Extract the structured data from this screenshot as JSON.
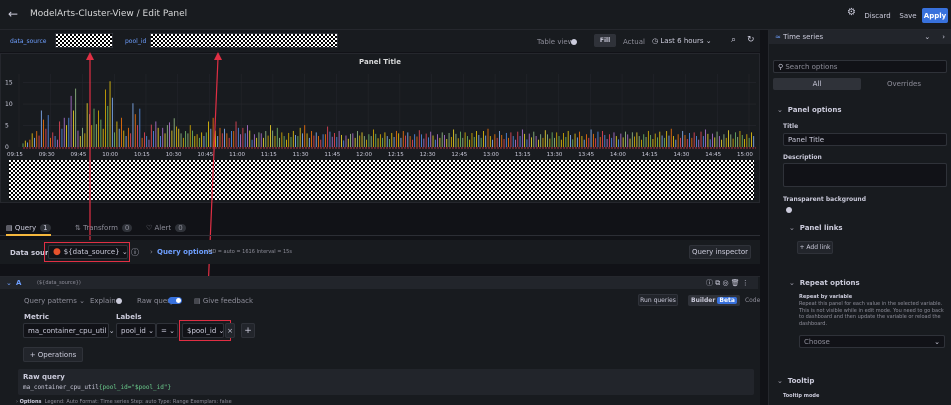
{
  "topbar": {
    "back_icon": "arrow-left-icon",
    "title": "ModelArts-Cluster-View / Edit Panel",
    "settings_icon": "gear-icon",
    "discard_label": "Discard",
    "save_label": "Save",
    "apply_label": "Apply"
  },
  "vars": {
    "data_source_label": "data_source",
    "pool_id_label": "pool_id",
    "table_view_label": "Table view",
    "fill_label": "Fill",
    "actual_label": "Actual",
    "time_range_label": "Last 6 hours",
    "zoom_icon": "zoom-out-icon",
    "refresh_icon": "refresh-icon"
  },
  "panel": {
    "title": "Panel Title",
    "y_ticks": [
      "15",
      "10",
      "5",
      "0"
    ],
    "x_ticks": [
      "09:15",
      "09:30",
      "09:45",
      "10:00",
      "10:15",
      "10:30",
      "10:45",
      "11:00",
      "11:15",
      "11:30",
      "11:45",
      "12:00",
      "12:15",
      "12:30",
      "12:45",
      "13:00",
      "13:15",
      "13:30",
      "13:45",
      "14:00",
      "14:15",
      "14:30",
      "14:45",
      "15:00"
    ],
    "spike_heights": [
      0.1,
      0.25,
      0.5,
      0.2,
      0.4,
      0.8,
      0.3,
      0.6,
      0.5,
      0.9,
      0.4,
      0.3,
      0.6,
      0.2,
      0.35,
      0.3,
      0.45,
      0.25,
      0.3,
      0.2,
      0.4,
      0.3,
      0.25,
      0.35,
      0.3,
      0.2,
      0.25,
      0.3,
      0.2,
      0.22,
      0.3,
      0.25,
      0.2,
      0.28,
      0.22,
      0.18,
      0.25,
      0.2,
      0.24,
      0.2,
      0.22,
      0.25,
      0.2,
      0.23,
      0.21,
      0.2,
      0.22,
      0.24,
      0.2,
      0.22,
      0.25,
      0.2,
      0.22,
      0.2,
      0.24,
      0.21,
      0.2,
      0.23,
      0.2,
      0.22,
      0.21,
      0.2,
      0.24,
      0.22,
      0.2,
      0.21,
      0.23,
      0.2,
      0.22,
      0.21,
      0.25,
      0.2,
      0.22,
      0.2,
      0.24,
      0.21,
      0.2,
      0.23,
      0.22,
      0.2
    ]
  },
  "tabs": {
    "query_label": "Query",
    "query_count": "1",
    "transform_label": "Transform",
    "transform_count": "0",
    "alert_label": "Alert",
    "alert_count": "0"
  },
  "datasource_row": {
    "label": "Data source",
    "value": "${data_source}",
    "query_options_label": "Query options",
    "query_options_meta": "MD = auto = 1616   Interval = 15s",
    "inspector_label": "Query inspector"
  },
  "query": {
    "ref_id": "A",
    "ds_name": "(${data_source})",
    "patterns_label": "Query patterns",
    "explain_label": "Explain",
    "raw_query_label": "Raw query",
    "feedback_label": "Give feedback",
    "run_label": "Run queries",
    "builder_label": "Builder",
    "beta_label": "Beta",
    "code_label": "Code",
    "metric_label": "Metric",
    "labels_label": "Labels",
    "metric_value": "ma_container_cpu_util",
    "label_key": "pool_id",
    "operator": "=",
    "label_value": "$pool_id",
    "operations_label": "+ Operations",
    "raw_query_title": "Raw query",
    "raw_query_prefix": "ma_container_cpu_util",
    "raw_query_filter": "{pool_id=\"$pool_id\"}",
    "options_label": "Options",
    "options_summary": "Legend: Auto   Format: Time series   Step: auto   Type: Range   Exemplars: false"
  },
  "sidebar": {
    "viz_name": "Time series",
    "search_placeholder": "Search options",
    "tab_all": "All",
    "tab_overrides": "Overrides",
    "panel_options": "Panel options",
    "title_label": "Title",
    "title_value": "Panel Title",
    "description_label": "Description",
    "transparent_label": "Transparent background",
    "panel_links": "Panel links",
    "add_link_label": "+ Add link",
    "repeat_options": "Repeat options",
    "repeat_by_label": "Repeat by variable",
    "repeat_help": "Repeat this panel for each value in the selected variable. This is not visible while in edit mode. You need to go back to dashboard and then update the variable or reload the dashboard.",
    "choose_placeholder": "Choose",
    "tooltip": "Tooltip",
    "tooltip_mode": "Tooltip mode"
  },
  "colors": {
    "accent_blue": "#3871dc",
    "highlight_red": "#e02f44",
    "annotation_red": "#e02f44"
  }
}
